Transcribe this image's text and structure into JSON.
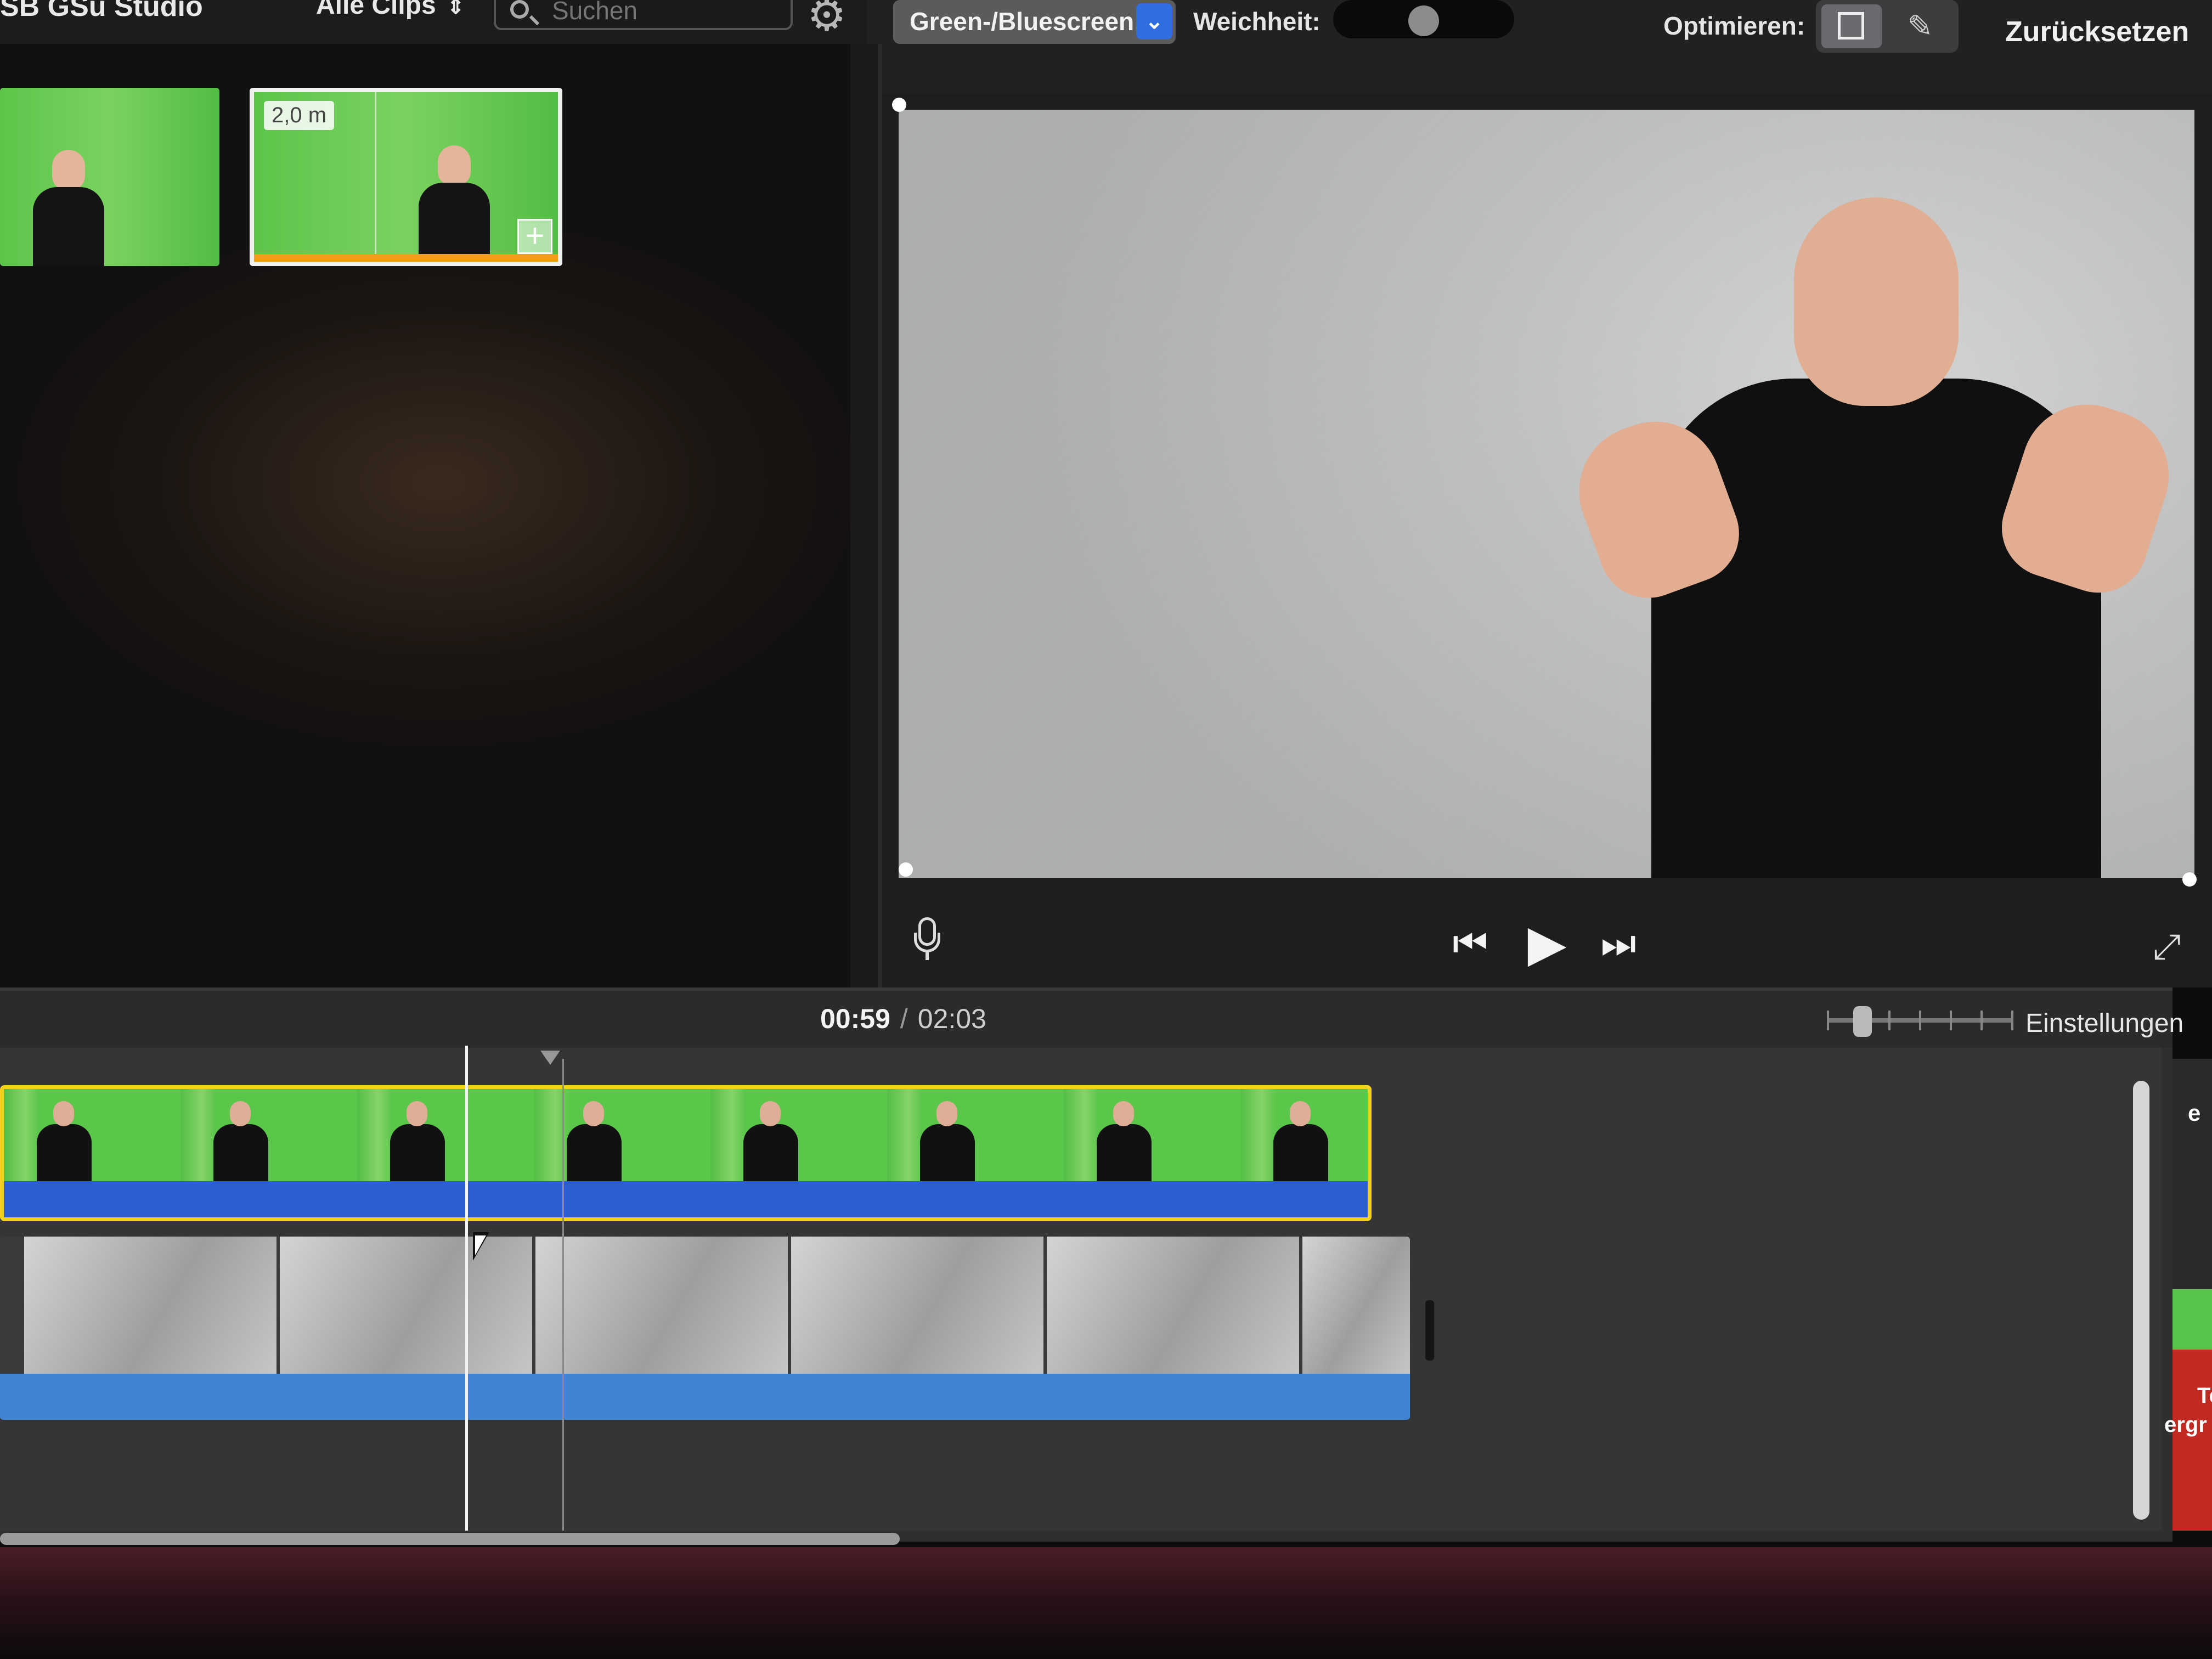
{
  "toolbar": {
    "app_title": "SB GSu Studio",
    "clips_filter": "Alle Clips",
    "search_placeholder": "Suchen"
  },
  "keyer": {
    "mode": "Green-/Bluescreen",
    "softness_label": "Weichheit:",
    "softness_value": 0.5,
    "optimize_label": "Optimieren:",
    "reset_label": "Zurücksetzen"
  },
  "browser": {
    "clips": [
      {
        "id": "clip-1"
      },
      {
        "id": "clip-2",
        "duration": "2,0 m"
      }
    ]
  },
  "timeline": {
    "current_time": "00:59",
    "separator": "/",
    "total_time": "02:03",
    "settings_label": "Einstellungen"
  },
  "side_panel": {
    "text_1": "e",
    "text_2": "Te",
    "text_3": "ergr"
  },
  "icons": {
    "search": "magnifier-icon",
    "settings": "gear-icon",
    "crop": "crop-icon",
    "eraser": "eraser-icon",
    "microphone": "microphone-icon",
    "skip_back": "skip-back-icon",
    "play": "play-icon",
    "skip_forward": "skip-forward-icon",
    "fullscreen": "fullscreen-icon"
  },
  "colors": {
    "accent": "#2f6ee0",
    "clip_selection": "#f3d21a",
    "clip_range": "#f59b1c",
    "audio_main": "#2b5ecf",
    "audio_bg": "#3f85d4"
  }
}
